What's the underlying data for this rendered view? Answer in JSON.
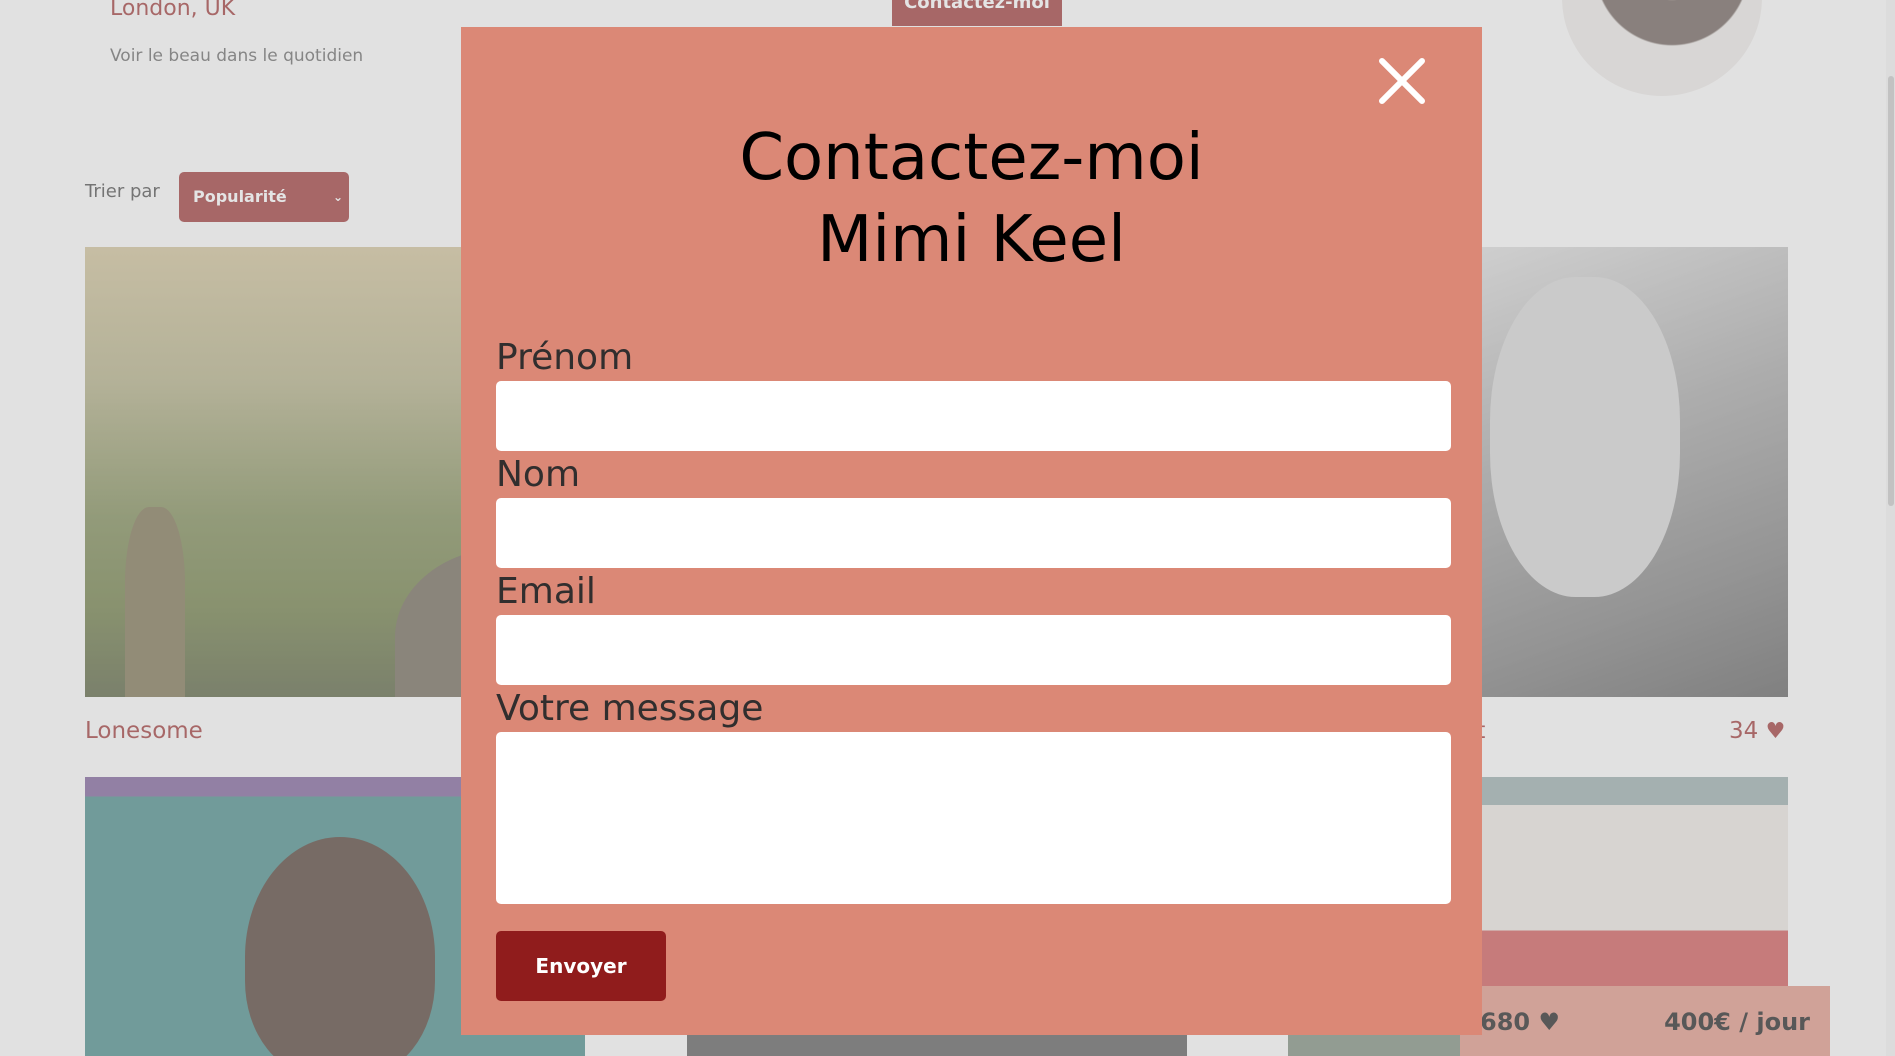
{
  "colors": {
    "primary": "#901c1c",
    "secondary": "#db8876",
    "overlay": "#c4c4c4"
  },
  "photographer": {
    "location": "London, UK",
    "tagline": "Voir le beau dans le quotidien",
    "contact_button": "Contactez-moi"
  },
  "sort": {
    "label": "Trier par",
    "selected": "Popularité"
  },
  "gallery": [
    {
      "title": "Lonesome",
      "likes": ""
    },
    {
      "title": "it",
      "likes": "34"
    }
  ],
  "footer_bar": {
    "total_likes": "680",
    "rate": "400€ / jour"
  },
  "modal": {
    "title_line1": "Contactez-moi",
    "title_line2": "Mimi Keel",
    "fields": {
      "first_name_label": "Prénom",
      "last_name_label": "Nom",
      "email_label": "Email",
      "message_label": "Votre message"
    },
    "submit_label": "Envoyer",
    "close_icon": "close-icon"
  }
}
